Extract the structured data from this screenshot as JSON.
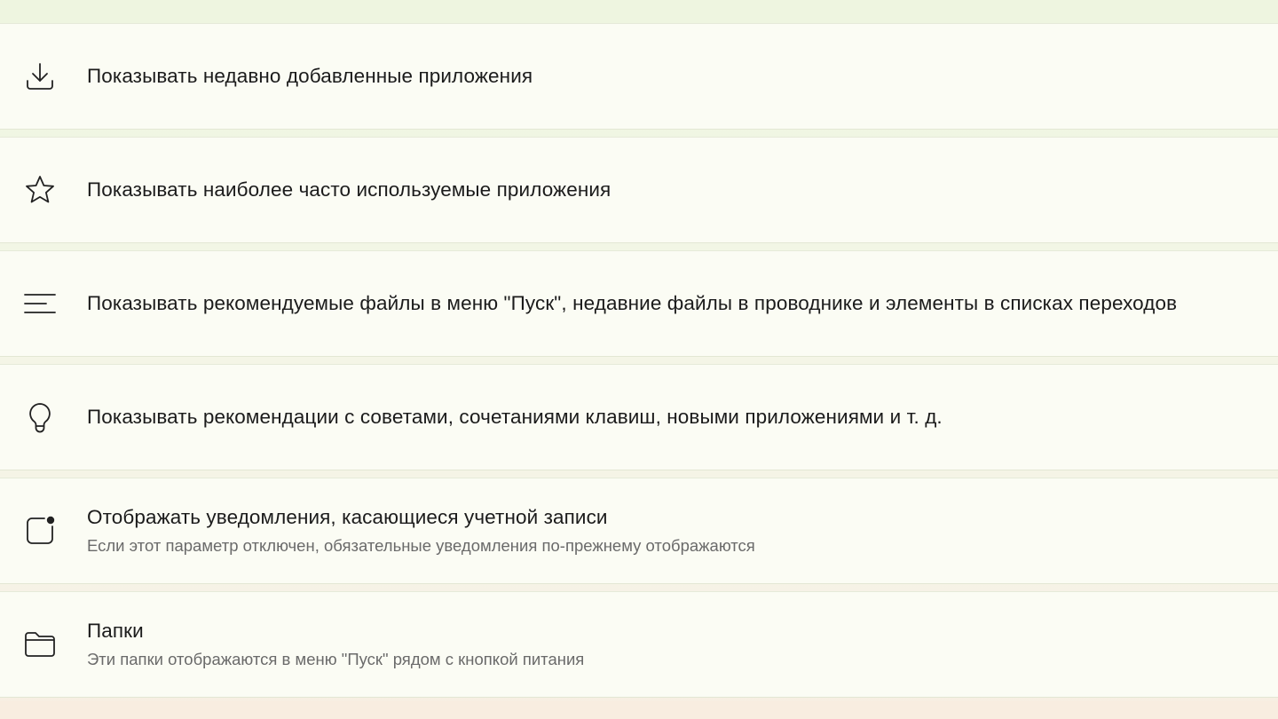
{
  "settings": {
    "items": [
      {
        "icon": "download-icon",
        "title": "Показывать недавно добавленные приложения",
        "subtitle": ""
      },
      {
        "icon": "star-icon",
        "title": "Показывать наиболее часто используемые приложения",
        "subtitle": ""
      },
      {
        "icon": "list-icon",
        "title": "Показывать рекомендуемые файлы в меню \"Пуск\", недавние файлы в проводнике и элементы в списках переходов",
        "subtitle": ""
      },
      {
        "icon": "lightbulb-icon",
        "title": "Показывать рекомендации с советами, сочетаниями клавиш, новыми приложениями и т. д.",
        "subtitle": ""
      },
      {
        "icon": "notification-badge-icon",
        "title": "Отображать уведомления, касающиеся учетной записи",
        "subtitle": "Если этот параметр отключен, обязательные уведомления по-прежнему отображаются"
      },
      {
        "icon": "folder-icon",
        "title": "Папки",
        "subtitle": "Эти папки отображаются в меню \"Пуск\" рядом с кнопкой питания"
      }
    ]
  }
}
